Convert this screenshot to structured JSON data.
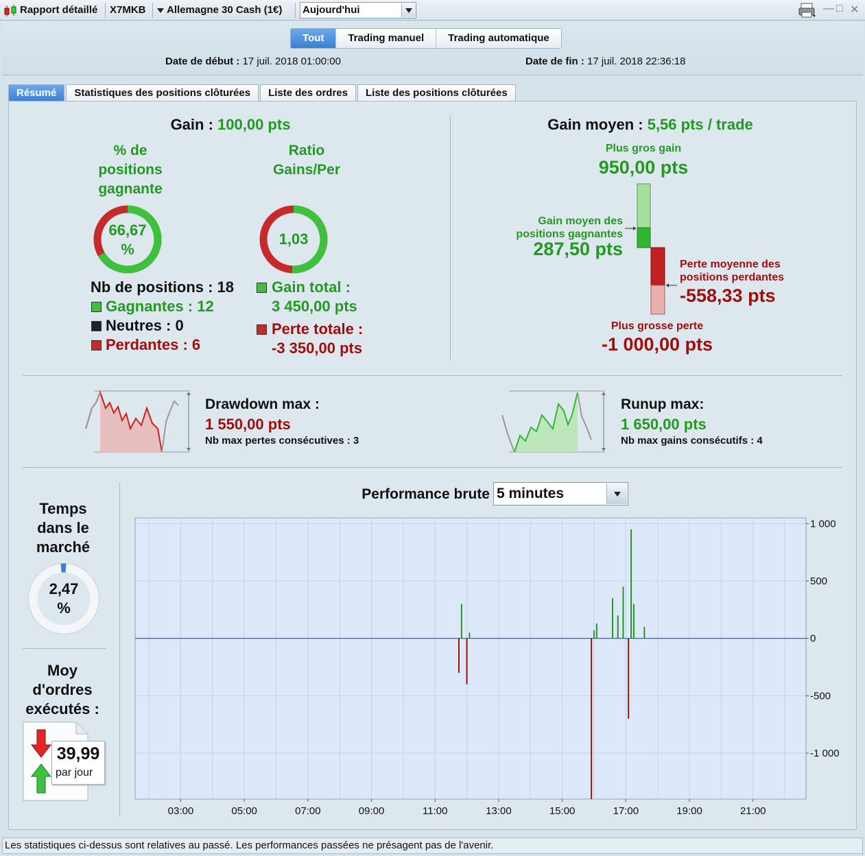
{
  "toolbar": {
    "report_label": "Rapport détaillé",
    "account": "X7MKB",
    "instrument": "Allemagne 30 Cash (1€)",
    "period_value": "Aujourd'hui"
  },
  "header": {
    "segments": [
      "Tout",
      "Trading manuel",
      "Trading automatique"
    ],
    "active_segment": "Tout",
    "start_label": "Date de début :",
    "start_value": "17 juil. 2018 01:00:00",
    "end_label": "Date de fin :",
    "end_value": "17 juil. 2018 22:36:18"
  },
  "tabs": [
    "Résumé",
    "Statistiques des positions clôturées",
    "Liste des ordres",
    "Liste des positions clôturées"
  ],
  "gain": {
    "label": "Gain :",
    "value": "100,00 pts",
    "win_pct_title_lines": [
      "% de",
      "positions",
      "gagnante"
    ],
    "win_pct_value": "66,67",
    "win_pct_unit": "%",
    "win_pct_fraction": 0.6667,
    "ratio_title_lines": [
      "Ratio",
      "Gains/Per"
    ],
    "ratio_value": "1,03",
    "ratio_fraction": 0.507,
    "nb_positions": "Nb de positions : 18",
    "winners": "Gagnantes : 12",
    "neutral": "Neutres : 0",
    "losers": "Perdantes : 6",
    "total_gain_label": "Gain total :",
    "total_gain_value": "3 450,00 pts",
    "total_loss_label": "Perte totale :",
    "total_loss_value": "-3 350,00 pts"
  },
  "avg": {
    "label": "Gain moyen :",
    "value": "5,56 pts / trade",
    "biggest_gain_label": "Plus gros gain",
    "biggest_gain_value": "950,00 pts",
    "avg_win_label_lines": [
      "Gain moyen des",
      "positions gagnantes"
    ],
    "avg_win_value": "287,50 pts",
    "avg_loss_label_lines": [
      "Perte moyenne des",
      "positions perdantes"
    ],
    "avg_loss_value": "-558,33 pts",
    "biggest_loss_label": "Plus grosse perte",
    "biggest_loss_value": "-1 000,00 pts"
  },
  "drawdown": {
    "label": "Drawdown max :",
    "value": "1 550,00 pts",
    "sub": "Nb max pertes consécutives : 3"
  },
  "runup": {
    "label": "Runup max:",
    "value": "1 650,00 pts",
    "sub": "Nb max gains consécutifs : 4"
  },
  "market_time": {
    "title_lines": [
      "Temps",
      "dans le",
      "marché"
    ],
    "value": "2,47",
    "unit": "%",
    "fraction": 0.0247
  },
  "orders": {
    "title_lines": [
      "Moy",
      "d'ordres",
      "exécutés :"
    ],
    "value": "39,99",
    "unit": "par jour"
  },
  "perf": {
    "title": "Performance brute",
    "interval": "5 minutes"
  },
  "chart_data": {
    "type": "bar",
    "x_ticks": [
      "03:00",
      "05:00",
      "07:00",
      "09:00",
      "11:00",
      "13:00",
      "15:00",
      "17:00",
      "19:00",
      "21:00"
    ],
    "y_ticks": [
      "1 000",
      "500",
      "0",
      "-500",
      "-1 000"
    ],
    "ylim": [
      -1400,
      1050
    ],
    "points": [
      {
        "x": "11:45",
        "y": -300
      },
      {
        "x": "11:50",
        "y": 300
      },
      {
        "x": "12:00",
        "y": -400
      },
      {
        "x": "12:05",
        "y": 50
      },
      {
        "x": "15:55",
        "y": -1400
      },
      {
        "x": "16:00",
        "y": 70
      },
      {
        "x": "16:05",
        "y": 130
      },
      {
        "x": "16:35",
        "y": 350
      },
      {
        "x": "16:45",
        "y": 200
      },
      {
        "x": "16:55",
        "y": 450
      },
      {
        "x": "17:05",
        "y": -700
      },
      {
        "x": "17:10",
        "y": 950
      },
      {
        "x": "17:15",
        "y": 300
      },
      {
        "x": "17:35",
        "y": 100
      }
    ]
  },
  "colors": {
    "gain": "#239923",
    "loss": "#a00d0d",
    "accent": "#3c7fd4"
  },
  "footer": "Les statistiques ci-dessus sont relatives au passé. Les performances passées ne présagent pas de l'avenir."
}
